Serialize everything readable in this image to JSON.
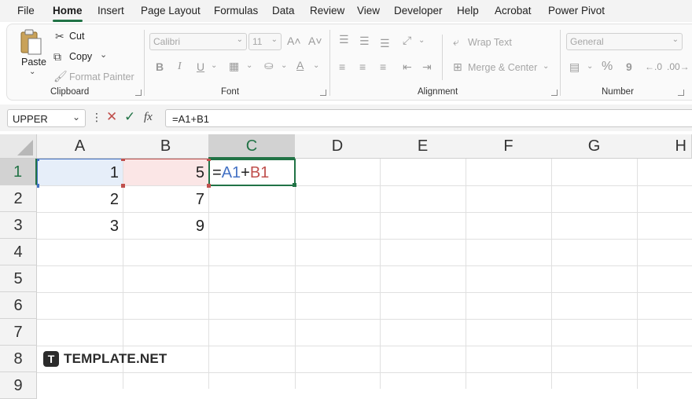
{
  "menu": {
    "items": [
      "File",
      "Home",
      "Insert",
      "Page Layout",
      "Formulas",
      "Data",
      "Review",
      "View",
      "Developer",
      "Help",
      "Acrobat",
      "Power Pivot"
    ],
    "active": "Home"
  },
  "ribbon": {
    "clipboard": {
      "label": "Clipboard",
      "paste": "Paste",
      "cut": "Cut",
      "copy": "Copy",
      "format_painter": "Format Painter"
    },
    "font": {
      "label": "Font",
      "font_name": "Calibri",
      "font_size": "11",
      "bold": "B",
      "italic": "I",
      "underline": "U"
    },
    "alignment": {
      "label": "Alignment",
      "wrap_text": "Wrap Text",
      "merge_center": "Merge & Center"
    },
    "number": {
      "label": "Number",
      "format": "General",
      "percent": "%",
      "comma": "9"
    }
  },
  "formula_bar": {
    "name_box": "UPPER",
    "fx": "fx",
    "formula": "=A1+B1"
  },
  "grid": {
    "columns": [
      "A",
      "B",
      "C",
      "D",
      "E",
      "F",
      "G",
      "H"
    ],
    "rows": [
      "1",
      "2",
      "3",
      "4",
      "5",
      "6",
      "7",
      "8",
      "9"
    ],
    "cells": {
      "A1": "1",
      "B1": "5",
      "A2": "2",
      "B2": "7",
      "A3": "3",
      "B3": "9"
    },
    "edit_cell": {
      "eq": "=",
      "ref1": "A1",
      "op": "+",
      "ref2": "B1"
    },
    "ref_colors": {
      "ref1": "#4472c4",
      "ref2": "#c0504d",
      "active": "#217346"
    }
  },
  "watermark": {
    "logo_letter": "T",
    "text": "TEMPLATE.NET"
  }
}
